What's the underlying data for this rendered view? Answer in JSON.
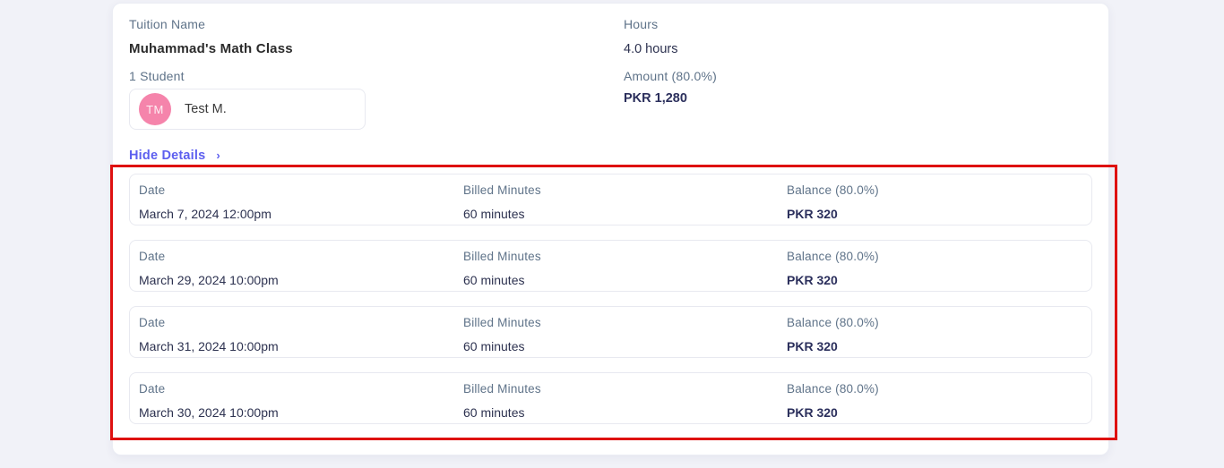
{
  "summary": {
    "tuition_label": "Tuition Name",
    "tuition_name": "Muhammad's Math Class",
    "students_label": "1 Student",
    "student": {
      "initials": "TM",
      "name": "Test M."
    },
    "hours_label": "Hours",
    "hours_value": "4.0 hours",
    "amount_label": "Amount (80.0%)",
    "amount_value": "PKR 1,280"
  },
  "toggle": {
    "label": "Hide Details",
    "chevron": "›"
  },
  "details": {
    "rows": [
      {
        "date_label": "Date",
        "date": "March 7, 2024 12:00pm",
        "minutes_label": "Billed Minutes",
        "minutes": "60 minutes",
        "balance_label": "Balance (80.0%)",
        "balance": "PKR 320"
      },
      {
        "date_label": "Date",
        "date": "March 29, 2024 10:00pm",
        "minutes_label": "Billed Minutes",
        "minutes": "60 minutes",
        "balance_label": "Balance (80.0%)",
        "balance": "PKR 320"
      },
      {
        "date_label": "Date",
        "date": "March 31, 2024 10:00pm",
        "minutes_label": "Billed Minutes",
        "minutes": "60 minutes",
        "balance_label": "Balance (80.0%)",
        "balance": "PKR 320"
      },
      {
        "date_label": "Date",
        "date": "March 30, 2024 10:00pm",
        "minutes_label": "Billed Minutes",
        "minutes": "60 minutes",
        "balance_label": "Balance (80.0%)",
        "balance": "PKR 320"
      }
    ]
  },
  "colors": {
    "page_background": "#f1f2f8",
    "label_slate": "#5f7389",
    "value_dark": "#2d3250",
    "amount_navy": "#2b2f5c",
    "link_purple": "#5d5fef",
    "avatar_pink": "#f584ab",
    "annotation_red": "#de1110"
  }
}
